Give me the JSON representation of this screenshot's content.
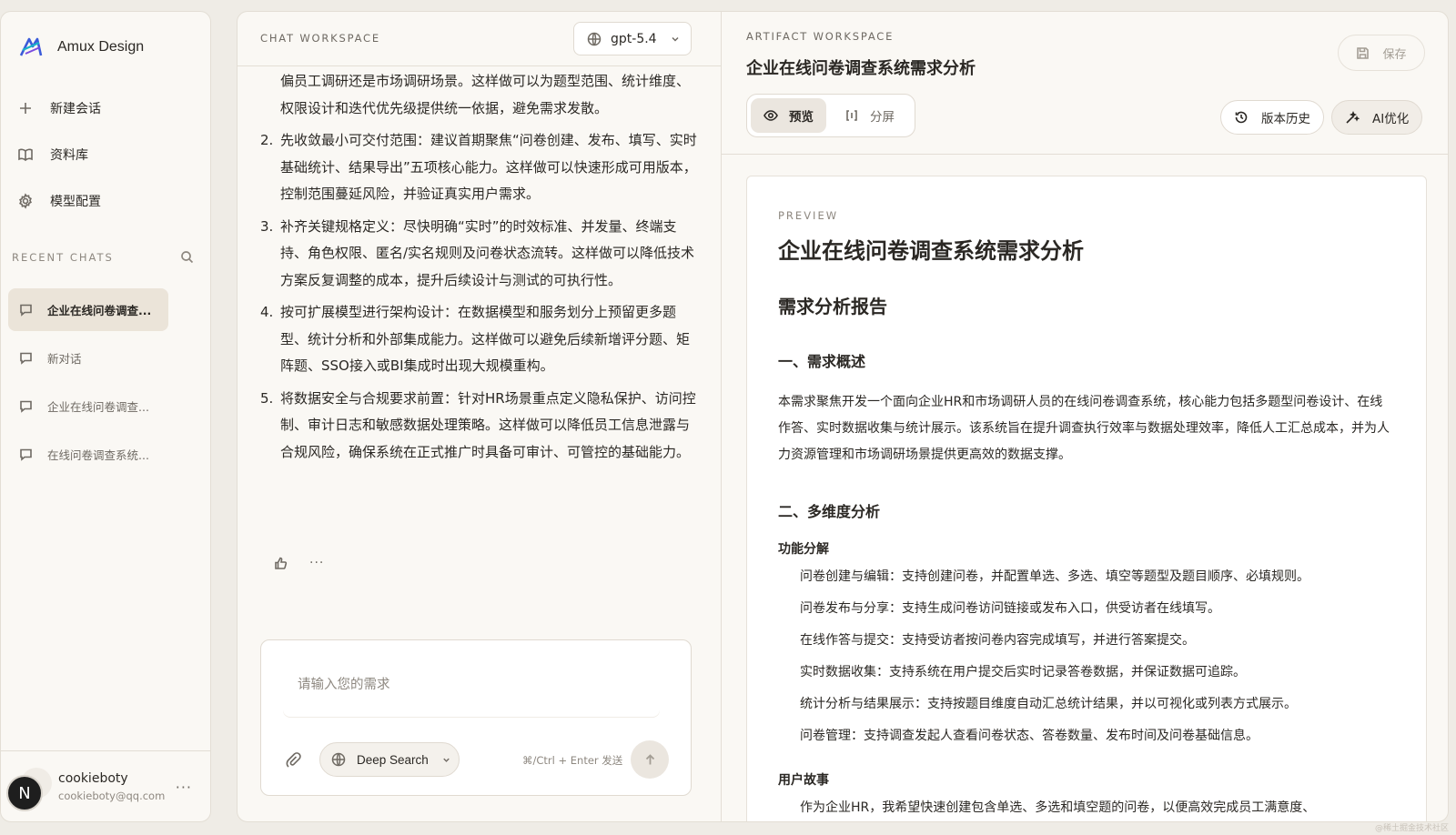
{
  "sidebar": {
    "brand": "Amux Design",
    "nav": [
      {
        "label": "新建会话",
        "icon": "plus-icon"
      },
      {
        "label": "资料库",
        "icon": "book-icon"
      },
      {
        "label": "模型配置",
        "icon": "gear-icon"
      }
    ],
    "recent_title": "RECENT CHATS",
    "recent_chats": [
      "企业在线问卷调查...",
      "新对话",
      "企业在线问卷调查...",
      "在线问卷调查系统..."
    ],
    "active_chat_index": 0,
    "user": {
      "initial": "N",
      "name": "cookieboty",
      "email": "cookieboty@qq.com"
    }
  },
  "chat": {
    "label": "CHAT WORKSPACE",
    "model": "gpt-5.4",
    "lead_text": "偏员工调研还是市场调研场景。这样做可以为题型范围、统计维度、权限设计和迭代优先级提供统一依据，避免需求发散。",
    "items": [
      {
        "num": "2.",
        "text": "先收敛最小可交付范围：建议首期聚焦“问卷创建、发布、填写、实时基础统计、结果导出”五项核心能力。这样做可以快速形成可用版本，控制范围蔓延风险，并验证真实用户需求。"
      },
      {
        "num": "3.",
        "text": "补齐关键规格定义：尽快明确“实时”的时效标准、并发量、终端支持、角色权限、匿名/实名规则及问卷状态流转。这样做可以降低技术方案反复调整的成本，提升后续设计与测试的可执行性。"
      },
      {
        "num": "4.",
        "text": "按可扩展模型进行架构设计：在数据模型和服务划分上预留更多题型、统计分析和外部集成能力。这样做可以避免后续新增评分题、矩阵题、SSO接入或BI集成时出现大规模重构。"
      },
      {
        "num": "5.",
        "text": "将数据安全与合规要求前置：针对HR场景重点定义隐私保护、访问控制、审计日志和敏感数据处理策略。这样做可以降低员工信息泄露与合规风险，确保系统在正式推广时具备可审计、可管控的基础能力。"
      }
    ],
    "more_label": "···",
    "composer": {
      "placeholder": "请输入您的需求",
      "deep_search": "Deep Search",
      "hint": "⌘/Ctrl + Enter 发送"
    }
  },
  "artifact": {
    "label": "ARTIFACT WORKSPACE",
    "title": "企业在线问卷调查系统需求分析",
    "save": "保存",
    "tabs": [
      {
        "label": "预览",
        "icon": "eye-icon"
      },
      {
        "label": "分屏",
        "icon": "code-icon"
      }
    ],
    "active_tab": 0,
    "version_history": "版本历史",
    "ai_optimize": "AI优化",
    "doc": {
      "kicker": "PREVIEW",
      "h1": "企业在线问卷调查系统需求分析",
      "h2": "需求分析报告",
      "section1": "一、需求概述",
      "overview": "本需求聚焦开发一个面向企业HR和市场调研人员的在线问卷调查系统，核心能力包括多题型问卷设计、在线作答、实时数据收集与统计展示。该系统旨在提升调查执行效率与数据处理效率，降低人工汇总成本，并为人力资源管理和市场调研场景提供更高效的数据支撑。",
      "section2": "二、多维度分析",
      "func_title": "功能分解",
      "functions": [
        "问卷创建与编辑：支持创建问卷，并配置单选、多选、填空等题型及题目顺序、必填规则。",
        "问卷发布与分享：支持生成问卷访问链接或发布入口，供受访者在线填写。",
        "在线作答与提交：支持受访者按问卷内容完成填写，并进行答案提交。",
        "实时数据收集：支持系统在用户提交后实时记录答卷数据，并保证数据可追踪。",
        "统计分析与结果展示：支持按题目维度自动汇总统计结果，并以可视化或列表方式展示。",
        "问卷管理：支持调查发起人查看问卷状态、答卷数量、发布时间及问卷基础信息。"
      ],
      "story_title": "用户故事",
      "stories": [
        "作为企业HR，我希望快速创建包含单选、多选和填空题的问卷，以便高效完成员工满意度、"
      ]
    }
  },
  "watermark": "@稀土掘金技术社区"
}
